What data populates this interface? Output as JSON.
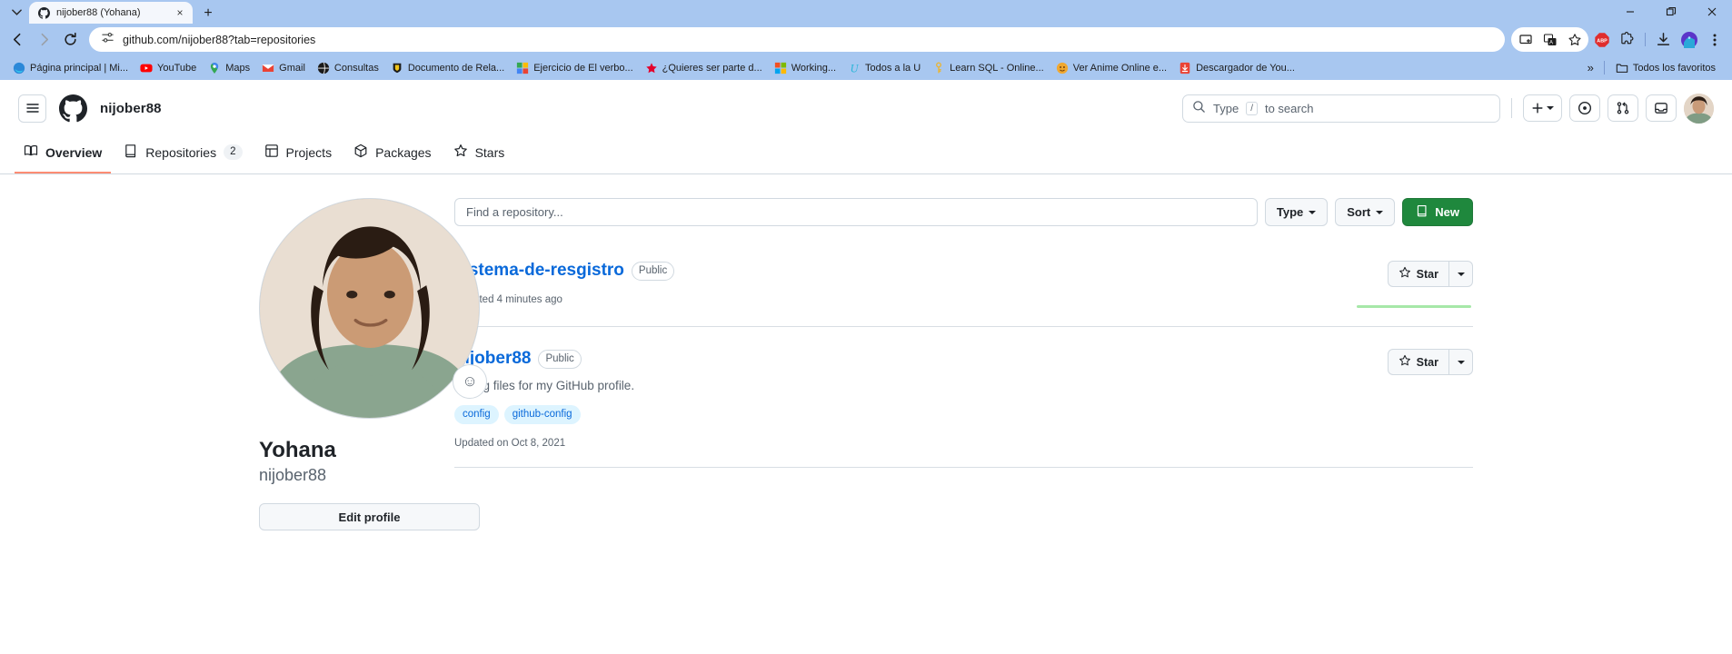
{
  "browser": {
    "tab": {
      "title": "nijober88 (Yohana)",
      "favicon": "github-icon",
      "close_label": "×"
    },
    "new_tab_label": "+",
    "window_controls": {
      "minimize": "—",
      "maximize": "❐",
      "close": "✕"
    },
    "nav": {
      "back": "←",
      "forward": "→",
      "reload": "⟳"
    },
    "omnibox": {
      "url": "github.com/nijober88?tab=repositories",
      "site_info_icon": "tune-icon"
    },
    "toolbar_icons": [
      "cast-icon",
      "translate-icon",
      "bookmark-star-icon",
      "adblock-icon",
      "extensions-icon",
      "downloads-icon",
      "profile-avatar-icon",
      "chrome-menu-icon"
    ],
    "bookmarks": [
      {
        "label": "Página principal | Mi...",
        "icon": "edge-icon"
      },
      {
        "label": "YouTube",
        "icon": "youtube-icon"
      },
      {
        "label": "Maps",
        "icon": "maps-pin-icon"
      },
      {
        "label": "Gmail",
        "icon": "gmail-icon"
      },
      {
        "label": "Consultas",
        "icon": "globe-dark-icon"
      },
      {
        "label": "Documento de Rela...",
        "icon": "crest-icon"
      },
      {
        "label": "Ejercicio de El verbo...",
        "icon": "docs-grid-icon"
      },
      {
        "label": "¿Quieres ser parte d...",
        "icon": "red-star-icon"
      },
      {
        "label": "Working...",
        "icon": "microsoft-icon"
      },
      {
        "label": "Todos a la U",
        "icon": "u-letter-icon"
      },
      {
        "label": "Learn SQL - Online...",
        "icon": "key-icon"
      },
      {
        "label": "Ver Anime Online e...",
        "icon": "orange-circle-icon"
      },
      {
        "label": "Descargador de You...",
        "icon": "download-red-icon"
      }
    ],
    "bookmarks_overflow": "»",
    "all_bookmarks": {
      "label": "Todos los favoritos",
      "icon": "folder-icon"
    }
  },
  "github": {
    "header": {
      "hamburger_icon": "hamburger-menu-icon",
      "logo_icon": "github-mark-icon",
      "owner": "nijober88",
      "search_placeholder": "Type",
      "search_key": "/",
      "search_suffix": "to search",
      "create_new_label": "+",
      "icons": [
        "issues-icon",
        "pull-requests-icon",
        "inbox-icon"
      ],
      "avatar": "user-avatar"
    },
    "nav_tabs": [
      {
        "label": "Overview",
        "icon": "book-icon",
        "count": null,
        "active": true
      },
      {
        "label": "Repositories",
        "icon": "repo-icon",
        "count": "2",
        "active": false
      },
      {
        "label": "Projects",
        "icon": "project-table-icon",
        "count": null,
        "active": false
      },
      {
        "label": "Packages",
        "icon": "package-icon",
        "count": null,
        "active": false
      },
      {
        "label": "Stars",
        "icon": "star-icon",
        "count": null,
        "active": false
      }
    ],
    "profile": {
      "avatar": "profile-photo",
      "status_emoji": "☺",
      "name": "Yohana",
      "login": "nijober88",
      "edit_button": "Edit profile"
    },
    "filters": {
      "find_placeholder": "Find a repository...",
      "find_value": "",
      "type_label": "Type",
      "sort_label": "Sort",
      "new_label": "New",
      "new_icon": "repo-icon"
    },
    "repositories": [
      {
        "name": "sistema-de-resgistro",
        "visibility": "Public",
        "description": "",
        "topics": [],
        "updated": "Updated 4 minutes ago",
        "star_label": "Star",
        "language_color": "#a6e8a8",
        "has_language_bar": true
      },
      {
        "name": "nijober88",
        "visibility": "Public",
        "description": "Config files for my GitHub profile.",
        "topics": [
          "config",
          "github-config"
        ],
        "updated": "Updated on Oct 8, 2021",
        "star_label": "Star",
        "language_color": "",
        "has_language_bar": false
      }
    ]
  },
  "colors": {
    "chrome_bg": "#a8c7f0",
    "link_blue": "#0969da",
    "green_btn": "#1f883d",
    "active_tab_underline": "#fd8c73",
    "topic_bg": "#ddf4ff"
  }
}
